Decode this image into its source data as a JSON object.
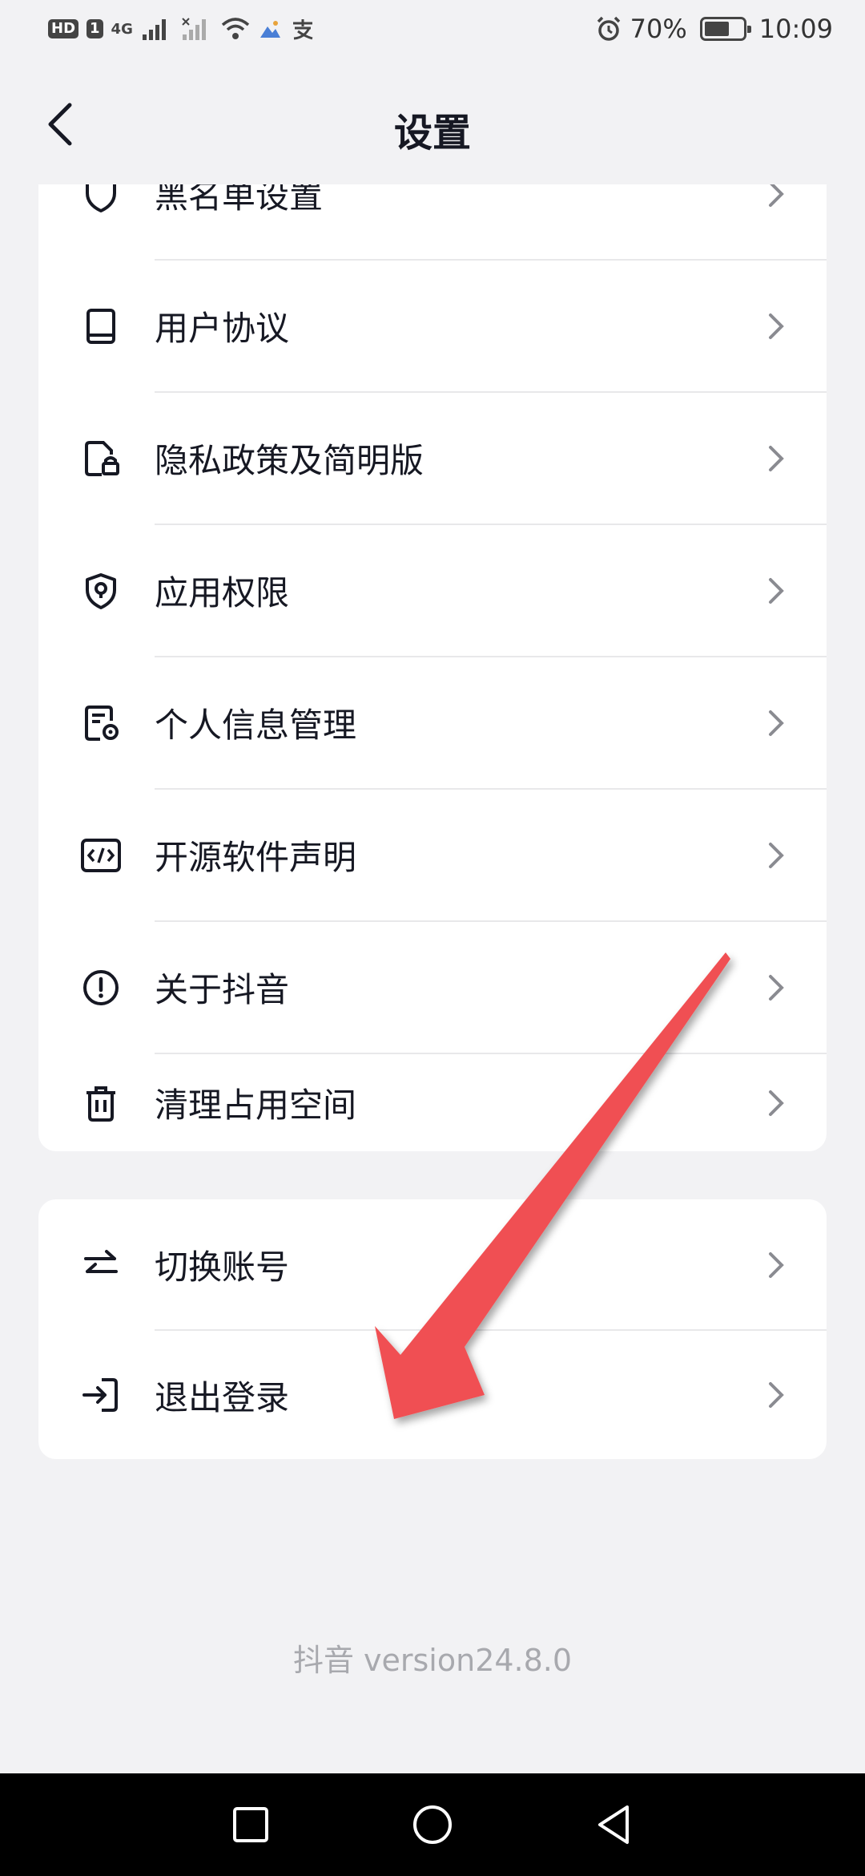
{
  "status_bar": {
    "hd": "HD",
    "sim": "1",
    "network": "4G",
    "battery": "70%",
    "battery_level": 0.7,
    "time": "10:09"
  },
  "nav": {
    "title": "设置"
  },
  "main_menu": [
    {
      "label": "黑名单设置",
      "icon": "shield-icon"
    },
    {
      "label": "用户协议",
      "icon": "book-icon"
    },
    {
      "label": "隐私政策及简明版",
      "icon": "file-lock-icon"
    },
    {
      "label": "应用权限",
      "icon": "permission-shield-icon"
    },
    {
      "label": "个人信息管理",
      "icon": "file-settings-icon"
    },
    {
      "label": "开源软件声明",
      "icon": "code-icon"
    },
    {
      "label": "关于抖音",
      "icon": "info-alert-icon"
    },
    {
      "label": "清理占用空间",
      "icon": "trash-icon"
    }
  ],
  "account_menu": [
    {
      "label": "切换账号",
      "icon": "switch-arrows-icon"
    },
    {
      "label": "退出登录",
      "icon": "logout-icon"
    }
  ],
  "footer": {
    "version": "抖音 version24.8.0"
  },
  "colors": {
    "background": "#f2f2f4",
    "card": "#ffffff",
    "arrow": "#f05052",
    "text": "#161823"
  }
}
